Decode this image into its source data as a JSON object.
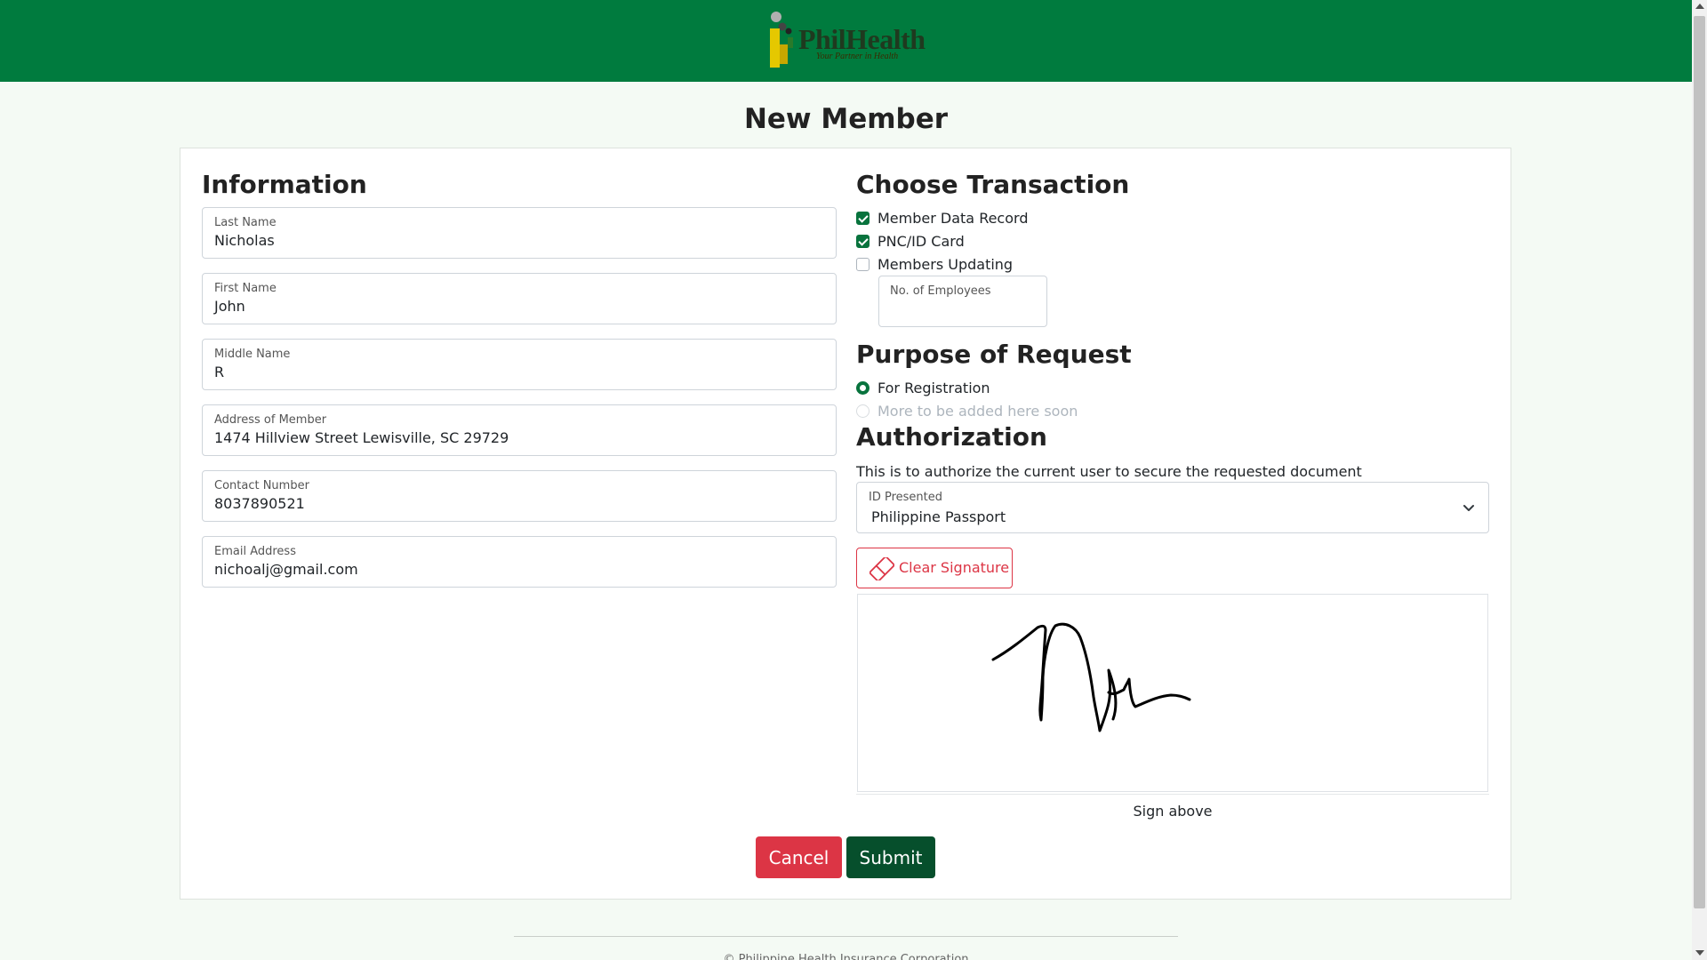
{
  "header": {
    "brand_name": "PhilHealth",
    "brand_tagline": "Your Partner in Health",
    "bar_color": "#007b3e"
  },
  "page_title": "New Member",
  "information": {
    "heading": "Information",
    "fields": [
      {
        "label": "Last Name",
        "value": "Nicholas"
      },
      {
        "label": "First Name",
        "value": "John"
      },
      {
        "label": "Middle Name",
        "value": "R"
      },
      {
        "label": "Address of Member",
        "value": "1474 Hillview Street Lewisville, SC 29729"
      },
      {
        "label": "Contact Number",
        "value": "8037890521"
      },
      {
        "label": "Email Address",
        "value": "nichoalj@gmail.com"
      }
    ]
  },
  "transaction": {
    "heading": "Choose Transaction",
    "options": [
      {
        "label": "Member Data Record",
        "checked": true
      },
      {
        "label": "PNC/ID Card",
        "checked": true
      },
      {
        "label": "Members Updating",
        "checked": false
      }
    ],
    "employees_label": "No. of Employees"
  },
  "purpose": {
    "heading": "Purpose of Request",
    "options": [
      {
        "label": "For Registration",
        "selected": true
      },
      {
        "label": "More to be added here soon",
        "selected": false,
        "disabled": true
      }
    ]
  },
  "authorization": {
    "heading": "Authorization",
    "description": "This is to authorize the current user to secure the requested document",
    "id_label": "ID Presented",
    "id_value": "Philippine Passport",
    "clear_label": "Clear Signature",
    "sign_hint": "Sign above"
  },
  "actions": {
    "cancel_label": "Cancel",
    "submit_label": "Submit"
  },
  "footer": {
    "text": "© Philippine Health Insurance Corporation"
  },
  "colors": {
    "primary_green": "#08733d",
    "danger": "#dc3545",
    "submit": "#064f2c"
  }
}
